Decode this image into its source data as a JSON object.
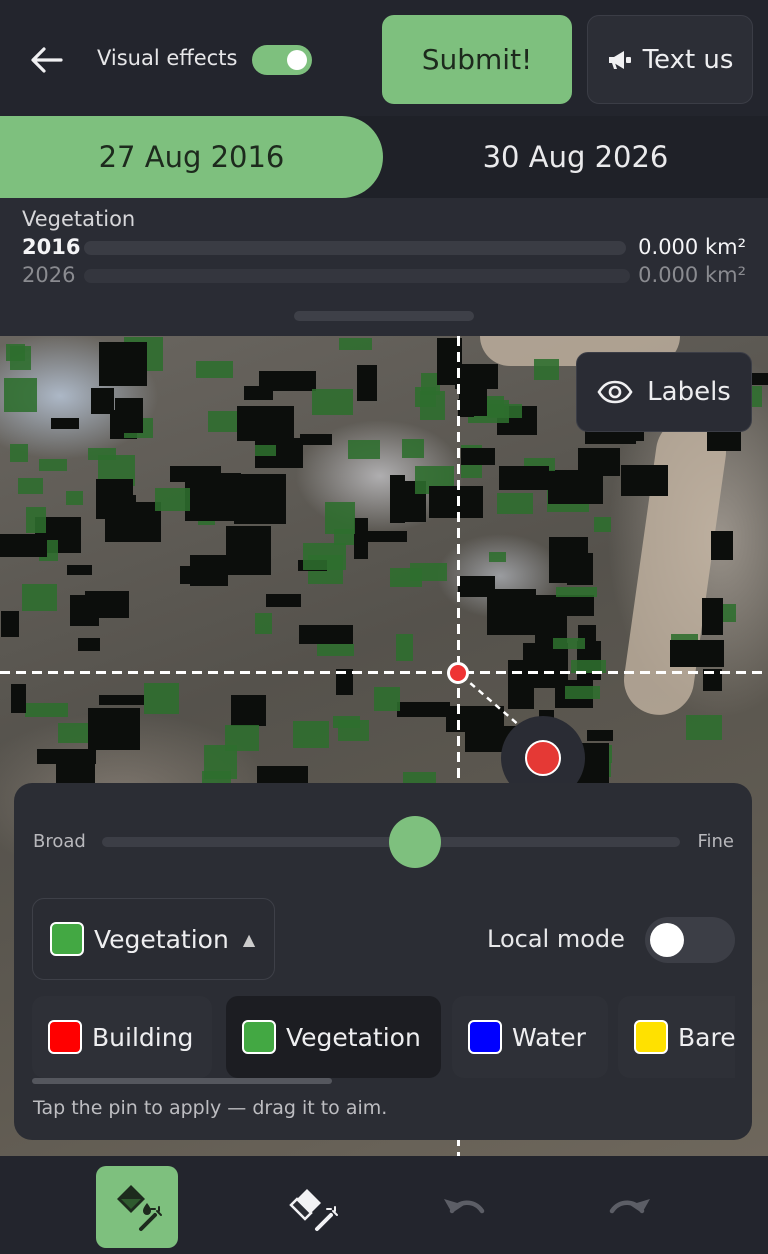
{
  "header": {
    "back_icon": "arrow-left-icon",
    "visual_effects_label": "Visual effects",
    "visual_effects_on": true,
    "submit_label": "Submit!",
    "text_us_label": "Text us",
    "text_us_icon": "megaphone-icon"
  },
  "dates": {
    "tabs": [
      {
        "label": "27 Aug 2016",
        "selected": true
      },
      {
        "label": "30 Aug 2026",
        "selected": false
      }
    ]
  },
  "stats": {
    "title": "Vegetation",
    "rows": [
      {
        "year": "2016",
        "value": "0.000 km²",
        "fraction": 0
      },
      {
        "year": "2026",
        "value": "0.000 km²",
        "fraction": 0
      }
    ]
  },
  "map": {
    "labels_button": "Labels",
    "labels_icon": "eye-icon"
  },
  "panel": {
    "slider_min_label": "Broad",
    "slider_max_label": "Fine",
    "slider_level": 0.55,
    "class_select": {
      "label": "Vegetation",
      "color": "#43a843"
    },
    "local_mode_label": "Local mode",
    "local_mode_on": false,
    "classes": [
      {
        "label": "Building",
        "color": "#ff0000",
        "selected": false
      },
      {
        "label": "Vegetation",
        "color": "#43a843",
        "selected": true
      },
      {
        "label": "Water",
        "color": "#0000ff",
        "selected": false
      },
      {
        "label": "Bare",
        "color": "#ffe100",
        "selected": false
      }
    ],
    "hint": "Tap the pin to apply — drag it to aim."
  },
  "toolbar": {
    "tools": [
      {
        "name": "fill-icon",
        "active": true
      },
      {
        "name": "eraser-icon",
        "active": false
      },
      {
        "name": "undo-icon",
        "active": false
      },
      {
        "name": "redo-icon",
        "active": false
      }
    ]
  },
  "colors": {
    "accent": "#7ec07e",
    "background": "#1f2128",
    "panel": "#2b2d34"
  }
}
